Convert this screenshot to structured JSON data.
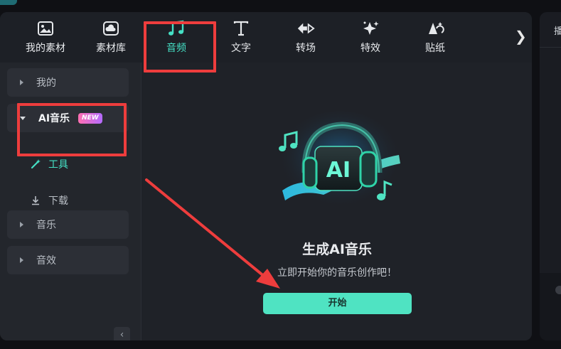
{
  "toolbar": {
    "items": [
      {
        "label": "我的素材",
        "icon": "image-icon"
      },
      {
        "label": "素材库",
        "icon": "cloud-folder-icon"
      },
      {
        "label": "音频",
        "icon": "music-note-icon",
        "active": true
      },
      {
        "label": "文字",
        "icon": "text-icon"
      },
      {
        "label": "转场",
        "icon": "transition-icon"
      },
      {
        "label": "特效",
        "icon": "sparkle-icon"
      },
      {
        "label": "贴纸",
        "icon": "sticker-icon"
      }
    ],
    "more_arrow": "❯"
  },
  "sidebar": {
    "items": [
      {
        "label": "我的"
      },
      {
        "label": "AI音乐",
        "badge": "NEW",
        "expanded": true
      },
      {
        "label": "音乐"
      },
      {
        "label": "音效"
      }
    ],
    "sub_items": [
      {
        "label": "工具",
        "active": true
      },
      {
        "label": "下载"
      }
    ],
    "collapse_glyph": "‹"
  },
  "main": {
    "hero_text": "AI",
    "title": "生成AI音乐",
    "subtitle": "立即开始你的音乐创作吧！",
    "start_label": "开始"
  },
  "right_panel": {
    "tab_label": "播"
  },
  "colors": {
    "accent": "#45e0c5",
    "button": "#4fe3c2",
    "highlight": "#ee3d3d",
    "panel": "#1d2026",
    "sidebar": "#23262c"
  }
}
